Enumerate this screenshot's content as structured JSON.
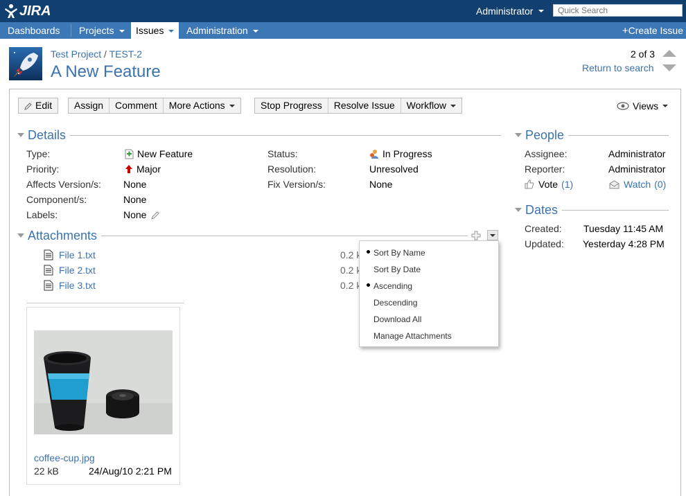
{
  "header": {
    "logo_text": "JIRA",
    "user": "Administrator",
    "search_placeholder": "Quick Search"
  },
  "nav": {
    "items": [
      {
        "label": "Dashboards"
      },
      {
        "label": "Projects"
      },
      {
        "label": "Issues"
      },
      {
        "label": "Administration"
      }
    ],
    "create_issue": "Create Issue"
  },
  "issue": {
    "project": "Test Project",
    "key": "TEST-2",
    "title": "A New Feature",
    "pager": "2 of 3",
    "return_to_search": "Return to search"
  },
  "toolbar": {
    "edit": "Edit",
    "assign": "Assign",
    "comment": "Comment",
    "more_actions": "More Actions",
    "stop_progress": "Stop Progress",
    "resolve_issue": "Resolve Issue",
    "workflow": "Workflow",
    "views": "Views"
  },
  "details": {
    "heading": "Details",
    "type_label": "Type:",
    "type_value": "New Feature",
    "priority_label": "Priority:",
    "priority_value": "Major",
    "affects_label": "Affects Version/s:",
    "affects_value": "None",
    "component_label": "Component/s:",
    "component_value": "None",
    "labels_label": "Labels:",
    "labels_value": "None",
    "status_label": "Status:",
    "status_value": "In Progress",
    "resolution_label": "Resolution:",
    "resolution_value": "Unresolved",
    "fix_label": "Fix Version/s:",
    "fix_value": "None"
  },
  "attachments": {
    "heading": "Attachments",
    "files": [
      {
        "name": "File 1.txt",
        "size": "0.2 k"
      },
      {
        "name": "File 2.txt",
        "size": "0.2 k"
      },
      {
        "name": "File 3.txt",
        "size": "0.2 k"
      }
    ],
    "image": {
      "name": "coffee-cup.jpg",
      "size": "22 kB",
      "date": "24/Aug/10 2:21 PM"
    },
    "menu": [
      {
        "label": "Sort By Name",
        "selected": true
      },
      {
        "label": "Sort By Date",
        "selected": false
      },
      {
        "label": "Ascending",
        "selected": true
      },
      {
        "label": "Descending",
        "selected": false
      },
      {
        "label": "Download All",
        "selected": false
      },
      {
        "label": "Manage Attachments",
        "selected": false
      }
    ]
  },
  "people": {
    "heading": "People",
    "assignee_label": "Assignee:",
    "assignee": "Administrator",
    "reporter_label": "Reporter:",
    "reporter": "Administrator",
    "vote_label": "Vote",
    "vote_count": "(1)",
    "watch_label": "Watch",
    "watch_count": "(0)"
  },
  "dates": {
    "heading": "Dates",
    "created_label": "Created:",
    "created": "Tuesday 11:45 AM",
    "updated_label": "Updated:",
    "updated": "Yesterday 4:28 PM"
  },
  "colors": {
    "header_bg": "#114070",
    "nav_bg": "#3c78b5",
    "link": "#3b73af"
  }
}
